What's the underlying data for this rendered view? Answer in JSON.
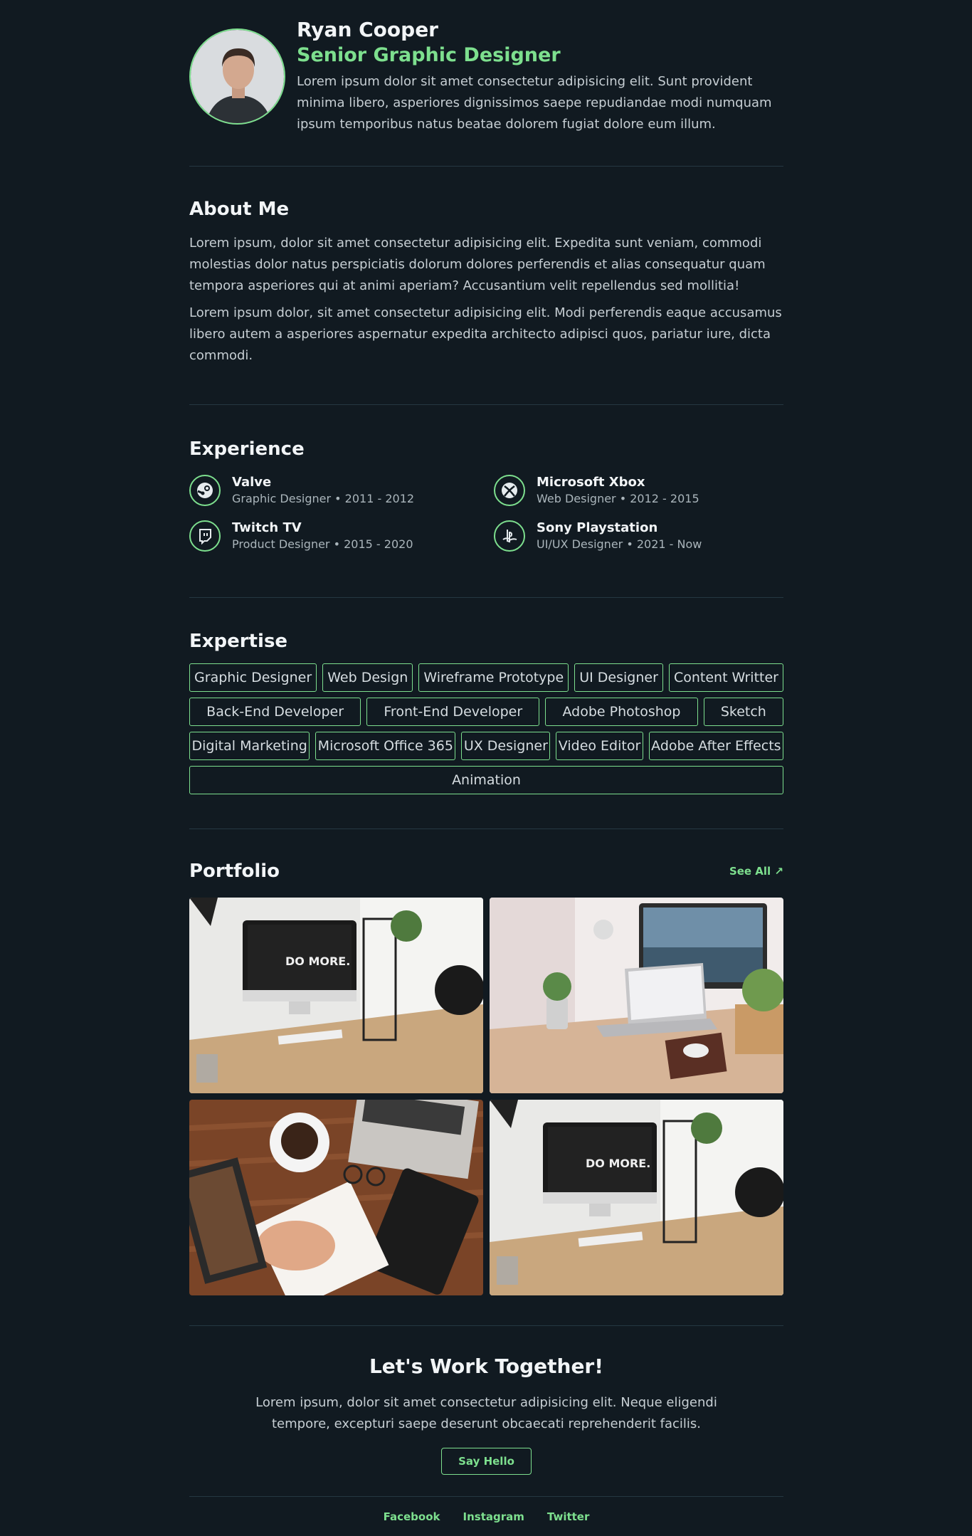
{
  "header": {
    "name": "Ryan Cooper",
    "role": "Senior Graphic Designer",
    "description": "Lorem ipsum dolor sit amet consectetur adipisicing elit. Sunt provident minima libero, asperiores dignissimos saepe repudiandae modi numquam ipsum temporibus natus beatae dolorem fugiat dolore eum illum."
  },
  "about": {
    "title": "About Me",
    "paragraphs": [
      "Lorem ipsum, dolor sit amet consectetur adipisicing elit. Expedita sunt veniam, commodi molestias dolor natus perspiciatis dolorum dolores perferendis et alias consequatur quam tempora asperiores qui at animi aperiam? Accusantium velit repellendus sed mollitia!",
      "Lorem ipsum dolor, sit amet consectetur adipisicing elit. Modi perferendis eaque accusamus libero autem a asperiores aspernatur expedita architecto adipisci quos, pariatur iure, dicta commodi."
    ]
  },
  "experience": {
    "title": "Experience",
    "items": [
      {
        "company": "Valve",
        "meta": "Graphic Designer • 2011 - 2012",
        "icon": "steam-icon"
      },
      {
        "company": "Microsoft Xbox",
        "meta": "Web Designer • 2012 - 2015",
        "icon": "xbox-icon"
      },
      {
        "company": "Twitch TV",
        "meta": "Product Designer • 2015 - 2020",
        "icon": "twitch-icon"
      },
      {
        "company": "Sony Playstation",
        "meta": "UI/UX Designer • 2021 - Now",
        "icon": "playstation-icon"
      }
    ]
  },
  "expertise": {
    "title": "Expertise",
    "rows": [
      [
        "Graphic Designer",
        "Web Design",
        "Wireframe Prototype",
        "UI Designer",
        "Content Writter"
      ],
      [
        "Back-End Developer",
        "Front-End Developer",
        "Adobe Photoshop",
        "Sketch"
      ],
      [
        "Digital Marketing",
        "Microsoft Office 365",
        "UX Designer",
        "Video Editor",
        "Adobe After Effects"
      ],
      [
        "Animation"
      ]
    ]
  },
  "portfolio": {
    "title": "Portfolio",
    "see_all": "See All ↗",
    "screen_text": "DO MORE."
  },
  "cta": {
    "title": "Let's Work Together!",
    "text": "Lorem ipsum, dolor sit amet consectetur adipisicing elit. Neque eligendi tempore, excepturi saepe deserunt obcaecati reprehenderit facilis.",
    "button": "Say Hello"
  },
  "footer": {
    "links": [
      "Facebook",
      "Instagram",
      "Twitter"
    ]
  },
  "colors": {
    "background": "#111a21",
    "accent": "#7ddf8e",
    "divider": "#253842"
  }
}
